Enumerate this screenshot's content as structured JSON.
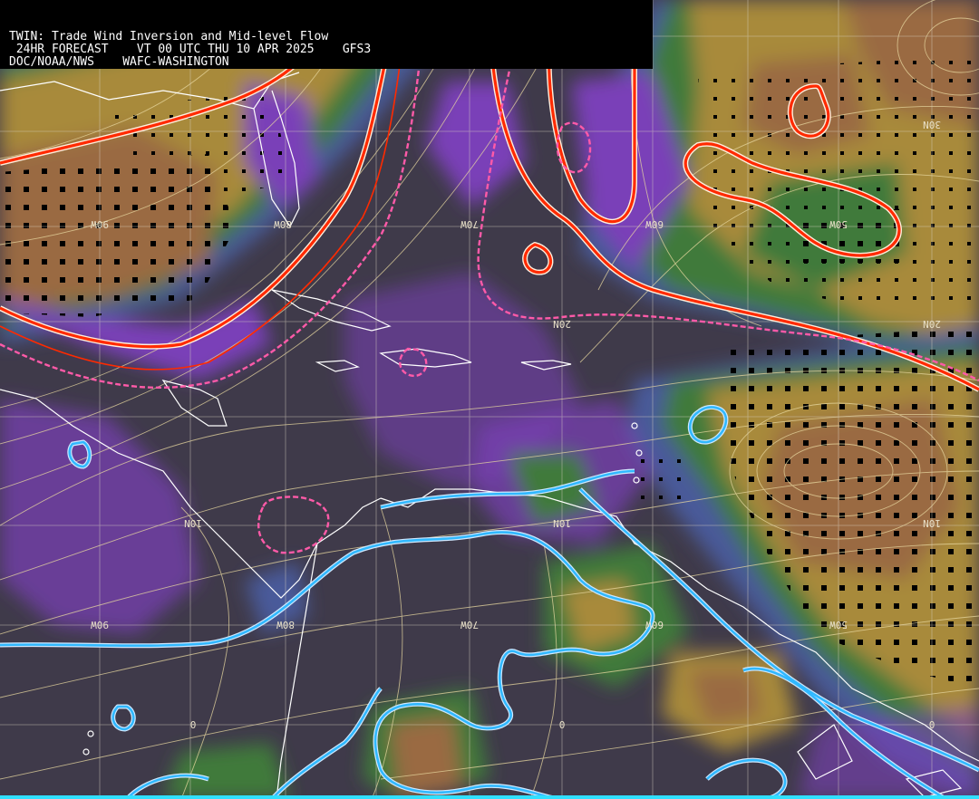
{
  "header": {
    "line1": "TWIN: Trade Wind Inversion and Mid-level Flow",
    "line2": " 24HR FORECAST    VT 00 UTC THU 10 APR 2025    GFS3",
    "line3": "DOC/NOAA/NWS    WAFC-WASHINGTON"
  },
  "grid_labels": {
    "lon_90w": "90W",
    "lon_80w": "80W",
    "lon_70w": "70W",
    "lon_60w": "60W",
    "lon_50w": "50W",
    "lat_30n": "30N",
    "lat_20n": "20N",
    "lat_10n": "10N",
    "lat_0": "0"
  },
  "colors": {
    "background_clear": "#3f3a4a",
    "purple_band": "#7a3fb8",
    "blue_band": "#4a5a9a",
    "green_band": "#3f7a3a",
    "olive_band": "#a88a3a",
    "brown_band": "#9a6a42",
    "inversion_red": "#ff2a00",
    "inversion_pink_dashed": "#ff5aa8",
    "low_level_cyan": "#30b8ff",
    "streamline": "#e8d8a0",
    "coastline": "#ffffff"
  }
}
